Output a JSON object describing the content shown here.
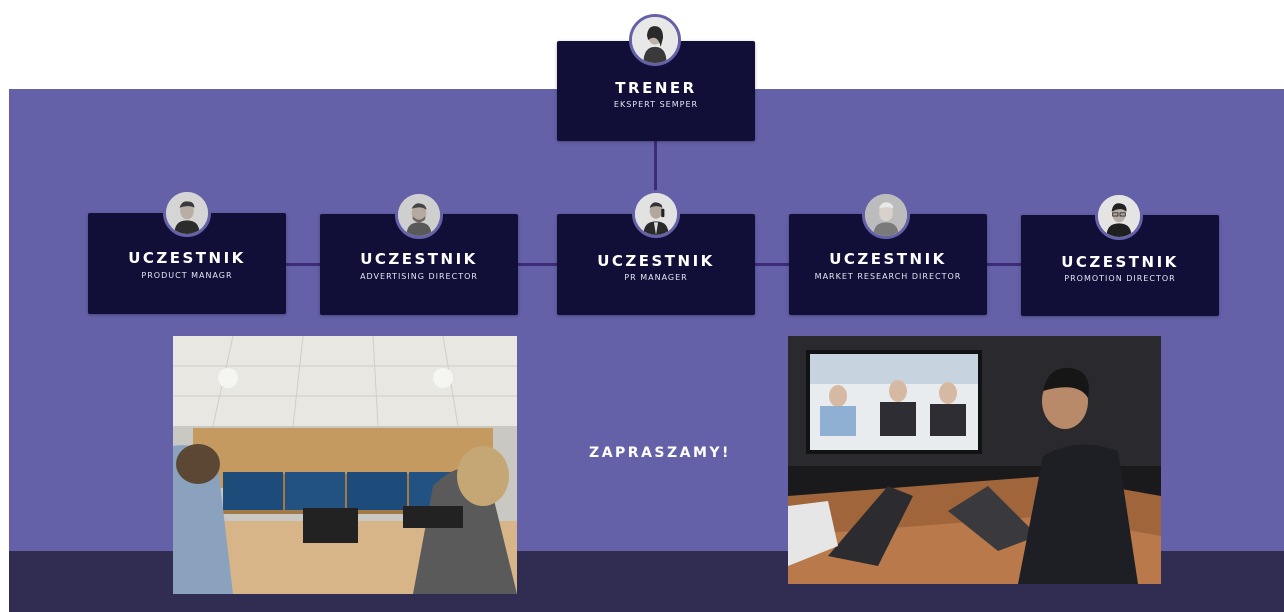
{
  "trainer": {
    "title": "TRENER",
    "subtitle": "EKSPERT SEMPER"
  },
  "participants": [
    {
      "title": "UCZESTNIK",
      "subtitle": "PRODUCT MANAGR"
    },
    {
      "title": "UCZESTNIK",
      "subtitle": "ADVERTISING DIRECTOR"
    },
    {
      "title": "UCZESTNIK",
      "subtitle": "PR MANAGER"
    },
    {
      "title": "UCZESTNIK",
      "subtitle": "MARKET RESEARCH DIRECTOR"
    },
    {
      "title": "UCZESTNIK",
      "subtitle": "PROMOTION DIRECTOR"
    }
  ],
  "invite_text": "ZAPRASZAMY!",
  "colors": {
    "band": "#6461a8",
    "card": "#110f38",
    "footer": "#302c52",
    "connector": "#3e2a7a"
  },
  "photos": [
    "videoconference-room-photo",
    "video-call-laptop-photo"
  ]
}
